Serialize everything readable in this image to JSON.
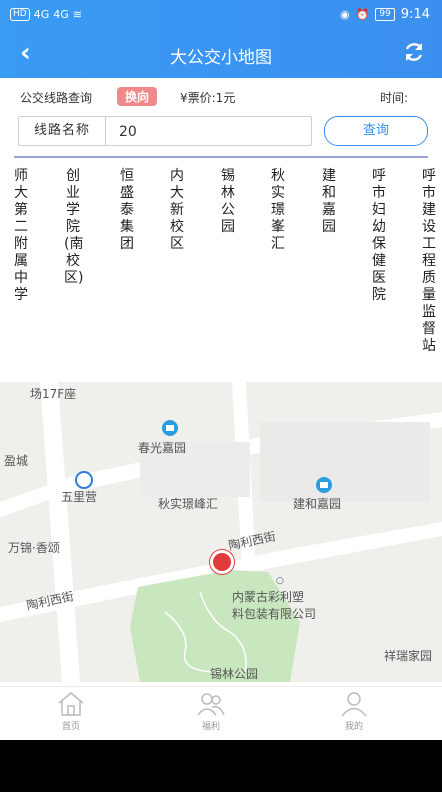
{
  "status_bar": {
    "left_chip": "HD",
    "network_1": "4G",
    "network_2": "4G",
    "battery": "99",
    "time": "9:14"
  },
  "app_bar": {
    "title": "大公交小地图",
    "back_icon": "chevron-left-icon",
    "refresh_icon": "refresh-icon"
  },
  "query": {
    "label": "公交线路查询",
    "swap_label": "换向",
    "fare": "¥票价:1元",
    "time_label": "时间:",
    "line_field_label": "线路名称",
    "line_value": "20",
    "search_label": "查询"
  },
  "stops": [
    "师大第二附属中学",
    "创业学院(南校区)",
    "恒盛泰集团",
    "内大新校区",
    "锡林公园",
    "秋实璟峯汇",
    "建和嘉园",
    "呼市妇幼保健医院",
    "呼市建设工程质量监督站"
  ],
  "map": {
    "labels": {
      "top_left": "场17F座",
      "chunguang": "春光嘉园",
      "left_city": "盈城",
      "wulying": "五里营",
      "qiushi": "秋实璟峰汇",
      "jianhe": "建和嘉园",
      "wanjin": "万锦·香颂",
      "taoli_street_right": "陶利西街",
      "taoli_street_left": "陶利西街",
      "company_1": "内蒙古彩利塑",
      "company_2": "料包装有限公司",
      "xiangrui": "祥瑞家园",
      "xilin": "锡林公园"
    },
    "colors": {
      "park": "#c9e7bf",
      "road": "#ffffff",
      "poi": "#2a9de0",
      "pin": "#e03c3c"
    }
  },
  "tabs": [
    {
      "label": "首页",
      "icon": "home-icon"
    },
    {
      "label": "福利",
      "icon": "users-icon"
    },
    {
      "label": "我的",
      "icon": "user-icon"
    }
  ],
  "theme": {
    "primary": "#3a8ef0",
    "swap_bg": "#f08a8a"
  }
}
